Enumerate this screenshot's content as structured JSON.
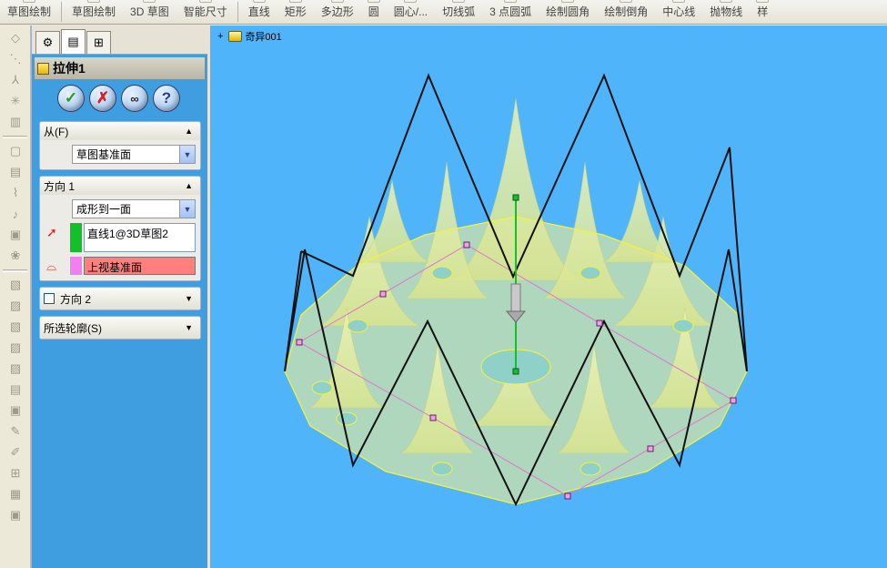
{
  "toolbar": {
    "items": [
      "草图绘制",
      "草图绘制",
      "3D 草图",
      "智能尺寸",
      "直线",
      "矩形",
      "多边形",
      "圆",
      "圆心/...",
      "切线弧",
      "3 点圆弧",
      "绘制圆角",
      "绘制倒角",
      "中心线",
      "抛物线",
      "样"
    ]
  },
  "panel": {
    "tabs": [
      "feature-tree",
      "property-manager",
      "configuration-manager"
    ],
    "feature_title": "拉伸1",
    "buttons": {
      "ok": "✓",
      "cancel": "✗",
      "detail": "∞",
      "help": "?"
    },
    "from": {
      "label": "从(F)",
      "value": "草图基准面"
    },
    "direction1": {
      "label": "方向 1",
      "end_condition": "成形到一面",
      "direction_ref": "直线1@3D草图2",
      "face_ref": "上视基准面"
    },
    "direction2": {
      "label": "方向 2"
    },
    "selected_contours": {
      "label": "所选轮廓(S)"
    }
  },
  "viewport": {
    "tree_node": "奇异001"
  },
  "colors": {
    "viewport_bg": "#50b4fb",
    "surface": "#eef3a0",
    "edge_yellow": "#f6f23a",
    "sketch_pink": "#e075c8",
    "axis_green": "#12c12a",
    "ok_green": "#2a9b1a",
    "cancel_red": "#d82020",
    "face_pink": "#ff7f7f"
  }
}
